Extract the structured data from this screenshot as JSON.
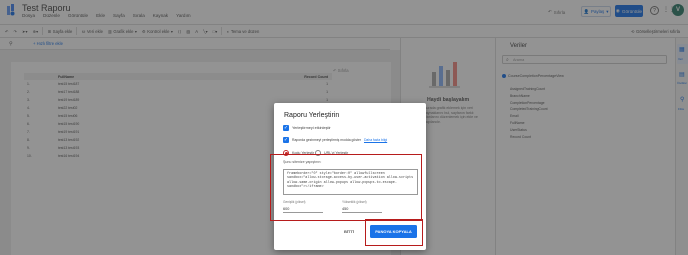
{
  "header": {
    "title": "Test Raporu",
    "menu": [
      "Dosya",
      "Düzenle",
      "Görüntüle",
      "Ekle",
      "Sayfa",
      "Sırala",
      "Kaynak",
      "Yardım"
    ],
    "reset_label": "Sıfırla",
    "share_label": "Paylaş",
    "view_label": "Görüntüle",
    "avatar_initial": "V"
  },
  "toolbar": {
    "add_page": "Sayfa ekle",
    "add_data": "Veri ekle",
    "add_chart": "Grafik ekle",
    "add_control": "Kontrol ekle",
    "theme": "Tema ve düzen",
    "reset_view": "Görselleştirmeleri sıfırla"
  },
  "filterbar": {
    "quick_filter": "+ Hızlı filtre ekle",
    "canvas_reset": "Sıfırla"
  },
  "table": {
    "columns": [
      "FullName",
      "Record Count"
    ],
    "rows": [
      {
        "idx": "1.",
        "name": "test15 test187",
        "count": "1"
      },
      {
        "idx": "2.",
        "name": "test17 test188",
        "count": "1"
      },
      {
        "idx": "3.",
        "name": "test19 test189",
        "count": "1"
      },
      {
        "idx": "4.",
        "name": "test22 test02",
        "count": "1"
      },
      {
        "idx": "5.",
        "name": "test15 test06",
        "count": "1"
      },
      {
        "idx": "6.",
        "name": "test15 test190",
        "count": "1"
      },
      {
        "idx": "7.",
        "name": "test19 test191",
        "count": "1"
      },
      {
        "idx": "8.",
        "name": "test13 test192",
        "count": "1"
      },
      {
        "idx": "9.",
        "name": "test13 test193",
        "count": "1"
      },
      {
        "idx": "10.",
        "name": "test16 test194",
        "count": "1"
      }
    ]
  },
  "right_panel": {
    "heading": "Haydi başlayalım",
    "body": "Burada grafik eklemek için veri kaynaklarını bul, sayfanın farklı alanlarını düzenlemek için ekle ve yapılandır."
  },
  "data_panel": {
    "title": "Veriler",
    "search_placeholder": "Arama",
    "source": "CourseCompletionPercentageView",
    "fields": [
      "AssignedTrainingCount",
      "BranchName",
      "CompletionPercentage",
      "CompletedTrainingCount",
      "Email",
      "FullName",
      "UserStatus",
      "Record Count"
    ],
    "rail": [
      "Veri",
      "Özellikler",
      "Filtre"
    ]
  },
  "dialog": {
    "title": "Raporu Yerleştirin",
    "opt_enable": "Yerleştirmeyi etkinleştir",
    "opt_consent": "Raporda gezinmeyi yerleştirmiş modda göster",
    "learn_more": "Daha fazla bilgi",
    "radio_code": "Kodu Yerleştir",
    "radio_url": "URL'yi Yerleştir",
    "code_label": "Şunu sitenize yapıştırın:",
    "code_text": "frameborder=\"0\" style=\"border:0\" allowfullscreen sandbox=\"allow-storage-access-by-user-activation allow-scripts allow-same-origin allow-popups allow-popups-to-escape-sandbox\"></iframe>",
    "width_label": "Genişlik (piksel)",
    "width_value": "600",
    "height_label": "Yükseklik (piksel)",
    "height_value": "450",
    "done_label": "BİTTİ",
    "copy_label": "PANOYA KOPYALA"
  }
}
